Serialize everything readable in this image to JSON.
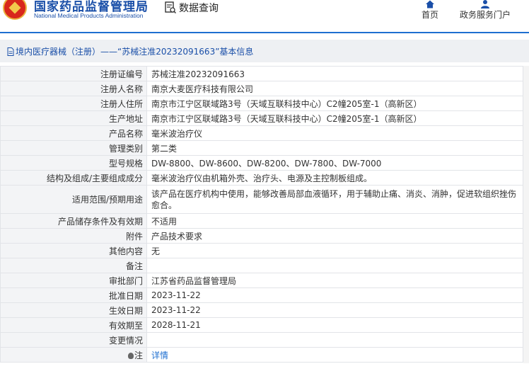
{
  "header": {
    "site_name": "国家药品监督管理局",
    "site_name_en": "National Medical Products Administration",
    "data_query": "数据查询",
    "nav_home": "首页",
    "nav_portal": "政务服务门户"
  },
  "breadcrumb": "境内医疗器械（注册）——“苏械注准20232091663”基本信息",
  "record": {
    "rows": [
      {
        "key": "注册证编号",
        "value": "苏械注准20232091663"
      },
      {
        "key": "注册人名称",
        "value": "南京大麦医疗科技有限公司"
      },
      {
        "key": "注册人住所",
        "value": "南京市江宁区联域路3号（天域互联科技中心）C2幢205室-1（高新区）"
      },
      {
        "key": "生产地址",
        "value": "南京市江宁区联域路3号（天域互联科技中心）C2幢205室-1（高新区）"
      },
      {
        "key": "产品名称",
        "value": "毫米波治疗仪"
      },
      {
        "key": "管理类别",
        "value": "第二类"
      },
      {
        "key": "型号规格",
        "value": "DW-8800、DW-8600、DW-8200、DW-7800、DW-7000"
      },
      {
        "key": "结构及组成/主要组成成分",
        "value": "毫米波治疗仪由机箱外壳、治疗头、电源及主控制板组成。"
      },
      {
        "key": "适用范围/预期用途",
        "value": "该产品在医疗机构中使用，能够改善局部血液循环，用于辅助止痛、消炎、消肿，促进软组织挫伤愈合。"
      },
      {
        "key": "产品储存条件及有效期",
        "value": "不适用"
      },
      {
        "key": "附件",
        "value": "产品技术要求"
      },
      {
        "key": "其他内容",
        "value": "无"
      },
      {
        "key": "备注",
        "value": ""
      },
      {
        "key": "审批部门",
        "value": "江苏省药品监督管理局"
      },
      {
        "key": "批准日期",
        "value": "2023-11-22"
      },
      {
        "key": "生效日期",
        "value": "2023-11-22"
      },
      {
        "key": "有效期至",
        "value": "2028-11-21"
      },
      {
        "key": "变更情况",
        "value": ""
      },
      {
        "key": "注",
        "value": "详情"
      }
    ]
  },
  "colors": {
    "brand_blue": "#1a4fa8",
    "link_blue": "#1e6fd0",
    "logo_red": "#d8271c"
  },
  "icons": [
    "emblem-logo",
    "data-query-icon",
    "home-icon",
    "user-icon",
    "document-icon",
    "bulb-icon"
  ]
}
